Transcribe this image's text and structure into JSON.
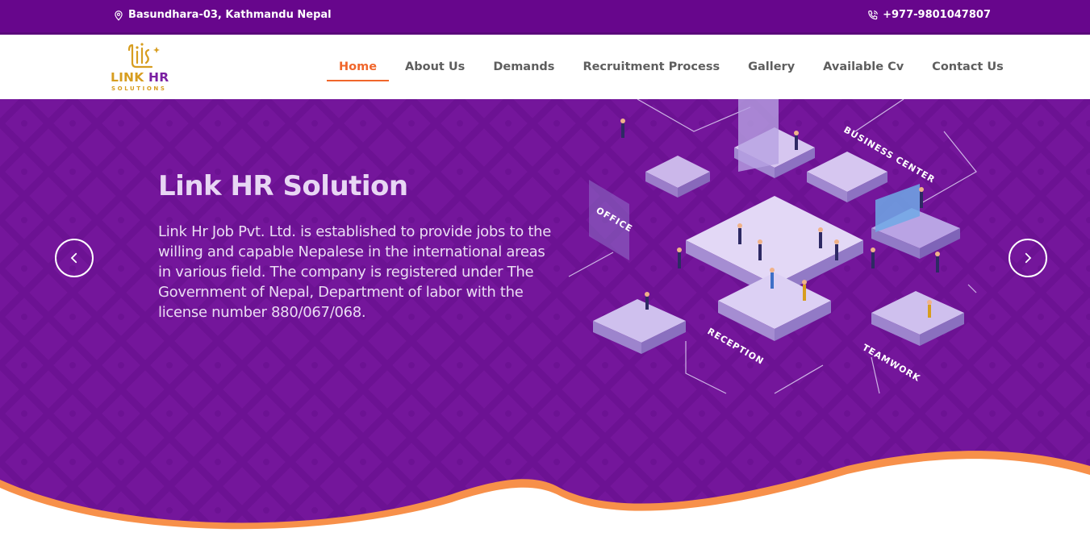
{
  "topbar": {
    "address": "Basundhara-03, Kathmandu Nepal",
    "phone": "+977-9801047807",
    "location_icon": "map-pin-icon",
    "phone_icon": "phone-icon"
  },
  "brand": {
    "name_part1": "LINK",
    "name_part2": "HR",
    "tagline": "SOLUTIONS",
    "gold": "#d79d1f",
    "purple": "#7a1fa2"
  },
  "nav": {
    "items": [
      {
        "label": "Home",
        "active": true
      },
      {
        "label": "About Us",
        "active": false
      },
      {
        "label": "Demands",
        "active": false
      },
      {
        "label": "Recruitment Process",
        "active": false
      },
      {
        "label": "Gallery",
        "active": false
      },
      {
        "label": "Available Cv",
        "active": false
      },
      {
        "label": "Contact Us",
        "active": false
      }
    ],
    "active_color": "#f0662b"
  },
  "hero": {
    "title": "Link HR Solution",
    "description": "Link Hr Job Pvt. Ltd. is established to provide jobs to the willing and capable Nepalese in the international areas in various field. The company is registered under The Government of Nepal, Department of labor with the license number 880/067/068.",
    "illustration_labels": {
      "business_center": "BUSINESS CENTER",
      "office": "OFFICE",
      "reception": "RECEPTION",
      "teamwork": "TEAMWORK"
    },
    "prev_icon": "chevron-left-icon",
    "next_icon": "chevron-right-icon",
    "background": "#74169b",
    "wave_accent": "#f7904a"
  }
}
